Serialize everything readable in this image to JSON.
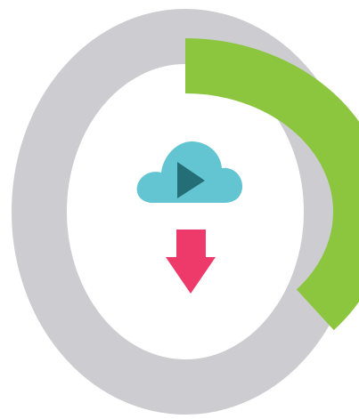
{
  "download_progress": {
    "fraction_complete": 0.36,
    "colors": {
      "track": "#cdccd1",
      "fill": "#8cc63f",
      "cloud": "#64c5d2",
      "play": "#236e77",
      "arrow": "#ee3a6a"
    },
    "icons": {
      "center": "cloud-play-icon",
      "below": "download-arrow-icon"
    }
  }
}
